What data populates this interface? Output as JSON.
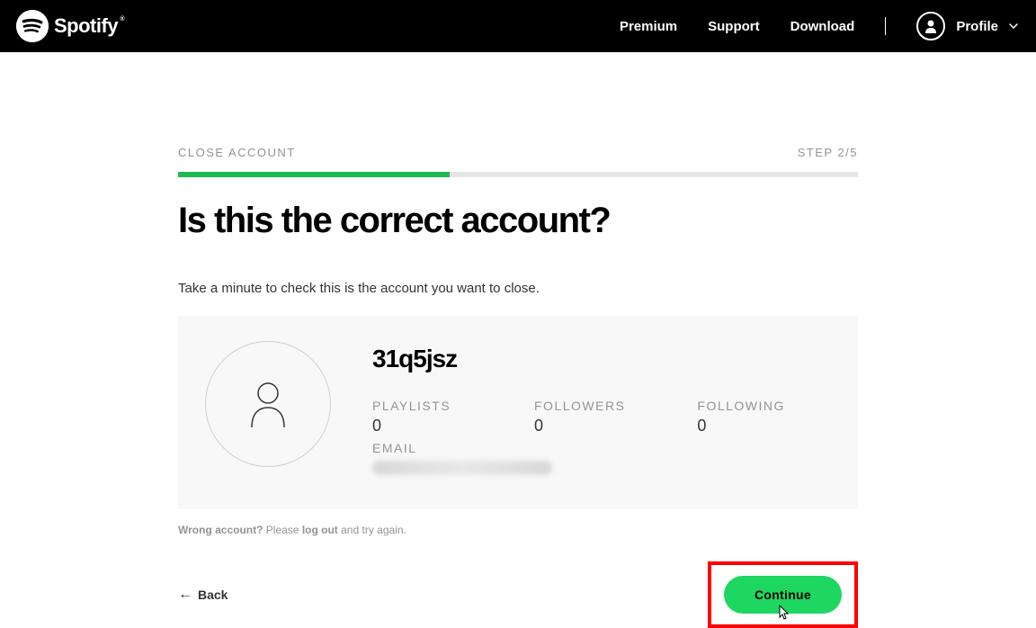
{
  "header": {
    "brand": "Spotify",
    "nav": {
      "premium": "Premium",
      "support": "Support",
      "download": "Download"
    },
    "profile_label": "Profile"
  },
  "breadcrumb": "CLOSE ACCOUNT",
  "step": "STEP 2/5",
  "progress_percent": 40,
  "title": "Is this the correct account?",
  "subtitle": "Take a minute to check this is the account you want to close.",
  "account": {
    "username": "31q5jsz",
    "stats": {
      "playlists_label": "PLAYLISTS",
      "playlists_value": "0",
      "followers_label": "FOLLOWERS",
      "followers_value": "0",
      "following_label": "FOLLOWING",
      "following_value": "0"
    },
    "email_label": "EMAIL"
  },
  "wrong_account": {
    "prefix": "Wrong account?",
    "please": " Please ",
    "logout": "log out",
    "suffix": " and try again."
  },
  "back_label": "Back",
  "continue_label": "Continue"
}
